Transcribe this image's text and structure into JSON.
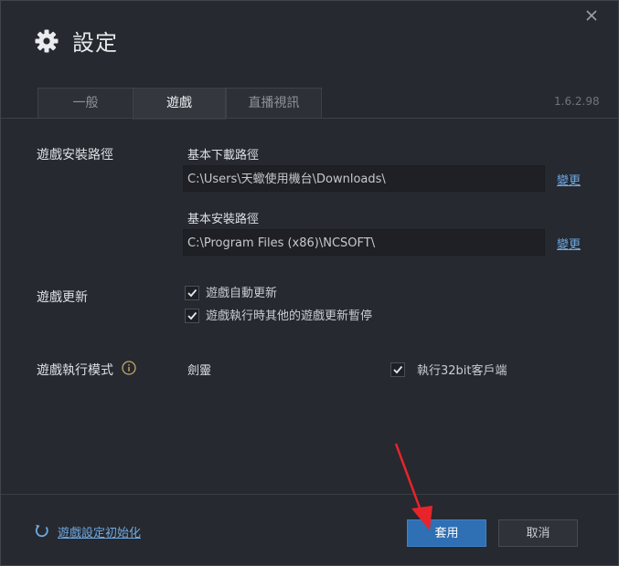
{
  "window": {
    "title": "設定",
    "version": "1.6.2.98"
  },
  "tabs": [
    {
      "label": "一般",
      "active": false
    },
    {
      "label": "遊戲",
      "active": true
    },
    {
      "label": "直播視訊",
      "active": false
    }
  ],
  "install_path": {
    "section_label": "遊戲安裝路徑",
    "download": {
      "label": "基本下載路徑",
      "value": "C:\\Users\\天蠍使用機台\\Downloads\\",
      "change_label": "變更"
    },
    "install": {
      "label": "基本安裝路徑",
      "value": "C:\\Program Files (x86)\\NCSOFT\\",
      "change_label": "變更"
    }
  },
  "update": {
    "section_label": "遊戲更新",
    "options": [
      {
        "label": "遊戲自動更新",
        "checked": true
      },
      {
        "label": "遊戲執行時其他的遊戲更新暫停",
        "checked": true
      }
    ]
  },
  "run_mode": {
    "section_label": "遊戲執行模式",
    "info_icon": "info-icon",
    "game": "劍靈",
    "option": {
      "label": "執行32bit客戶端",
      "checked": true
    }
  },
  "footer": {
    "reset_label": "遊戲設定初始化",
    "apply_label": "套用",
    "cancel_label": "取消"
  },
  "colors": {
    "background": "#26292f",
    "accent": "#2f6fb3",
    "link": "#6fa8e0",
    "annotation_arrow": "#e8242b"
  }
}
